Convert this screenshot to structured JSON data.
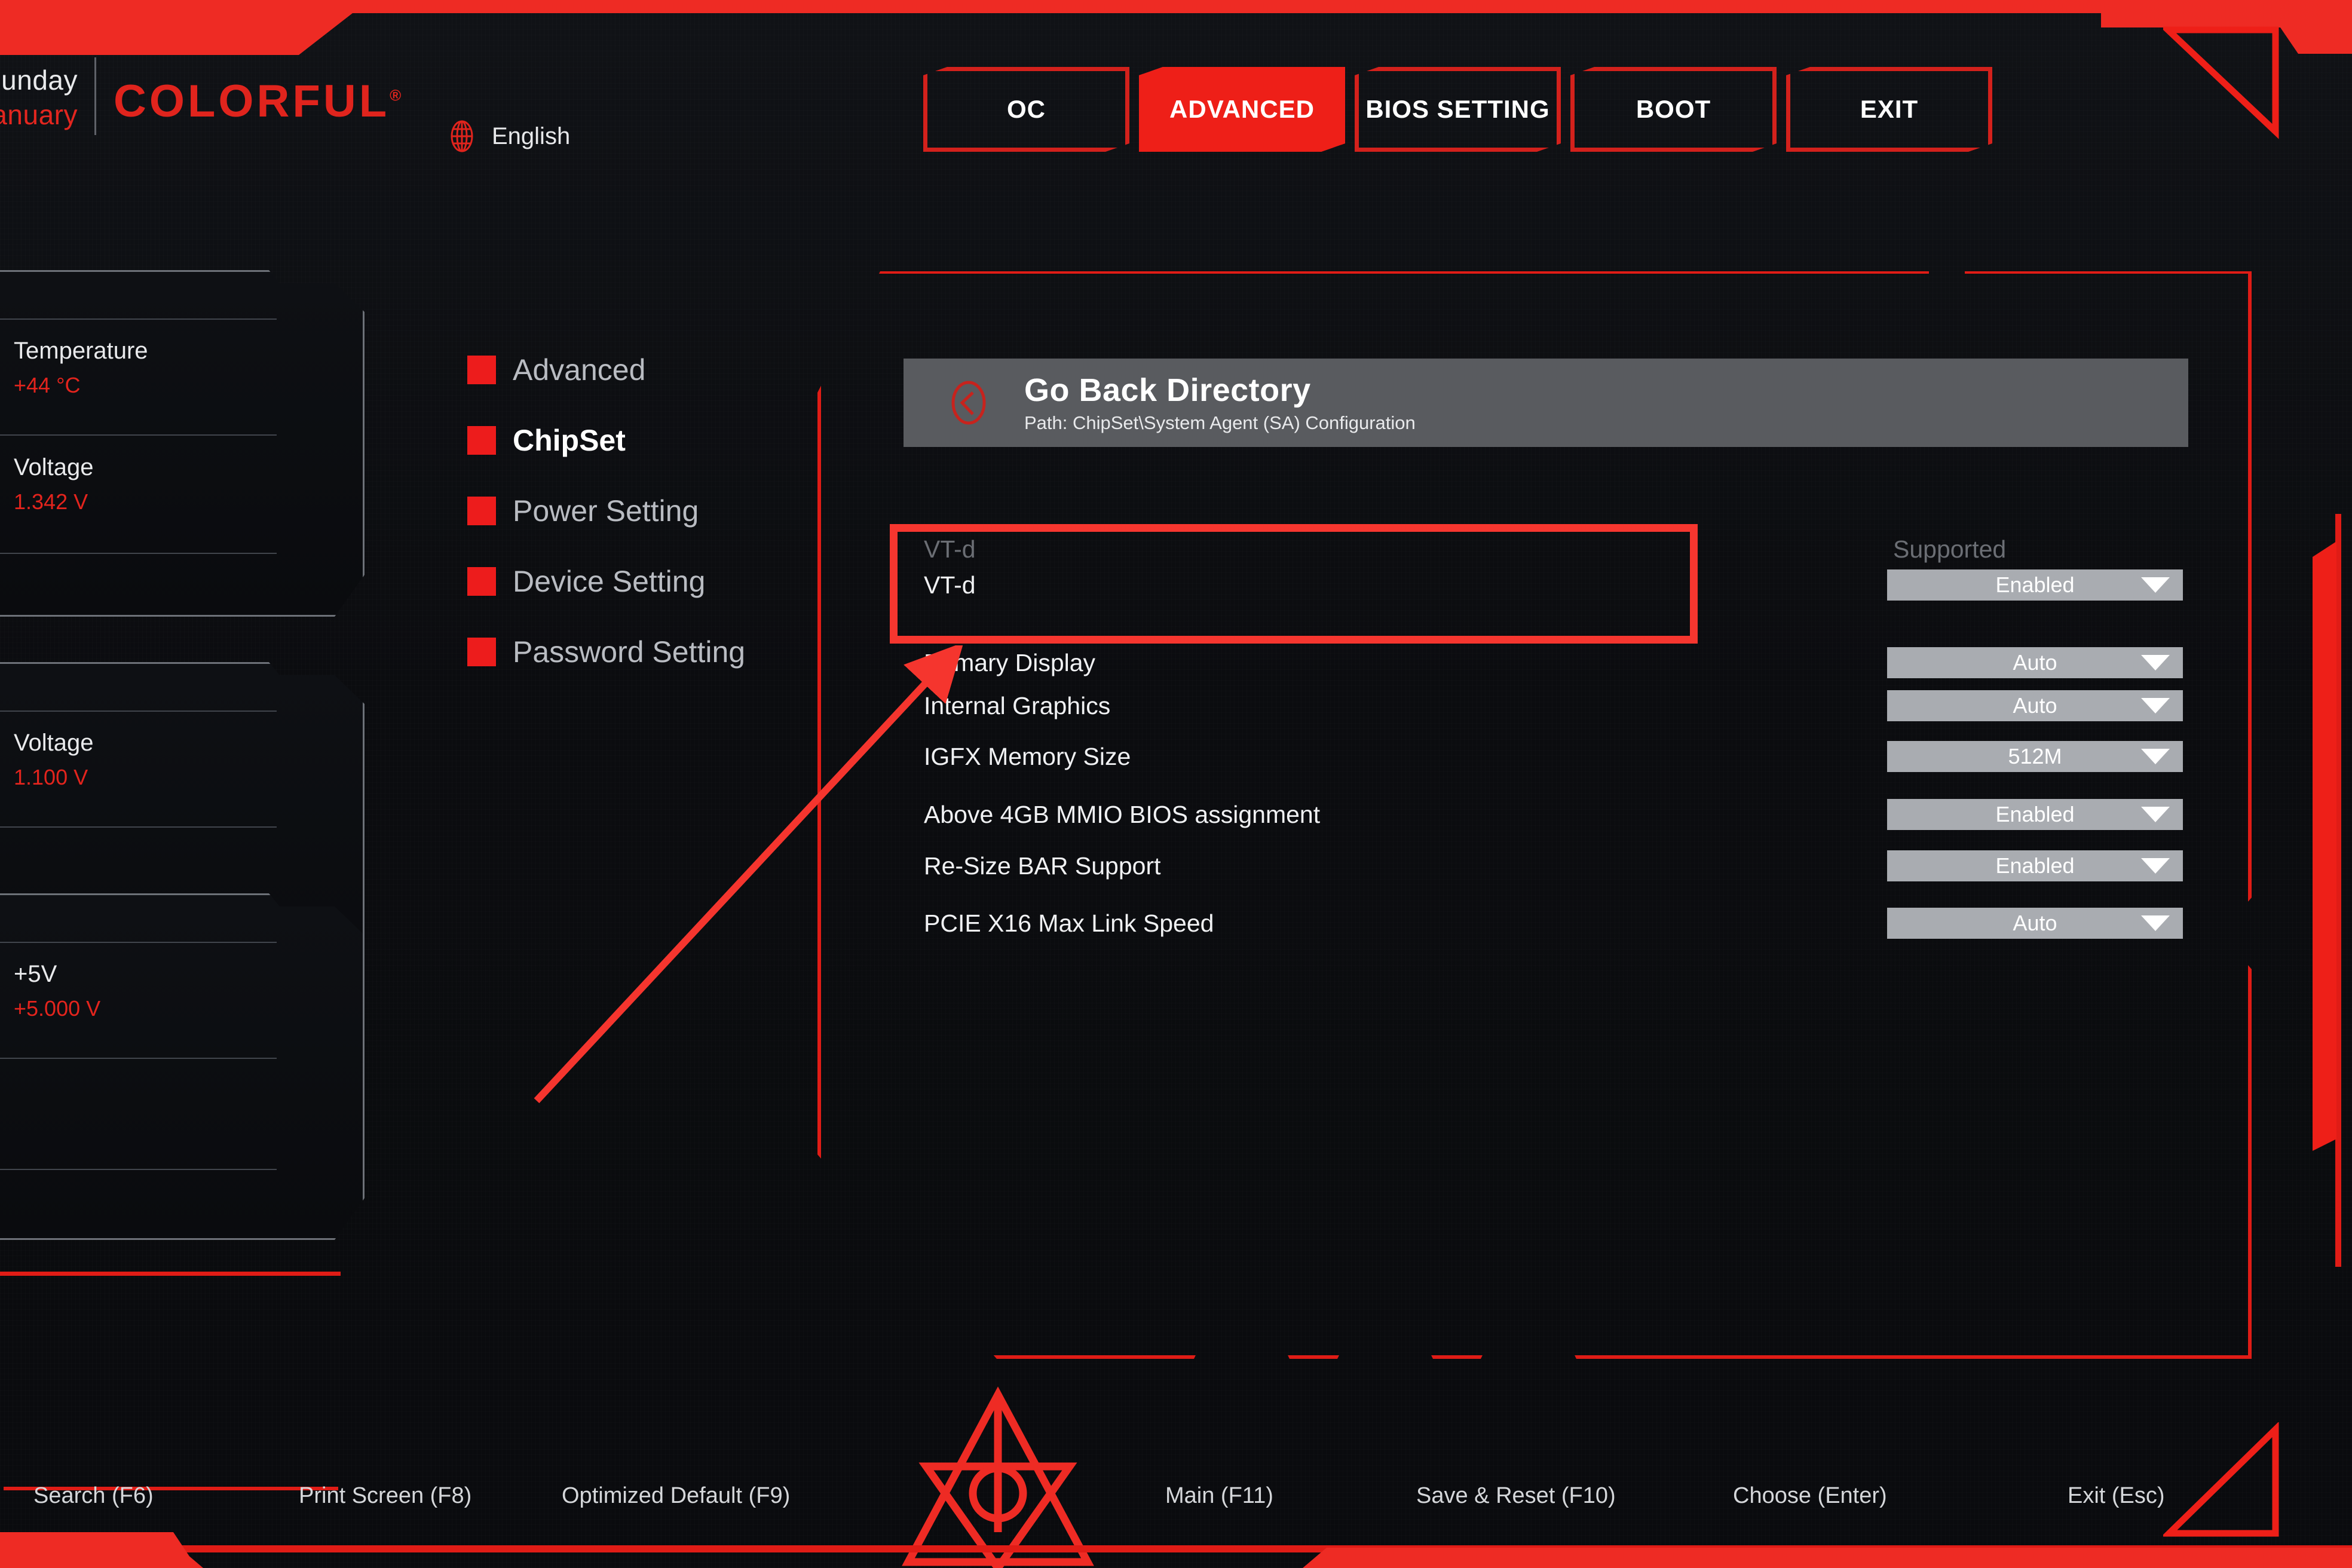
{
  "header": {
    "date_day": "Sunday",
    "date_month": "January",
    "brand": "COLORFUL",
    "brand_mark": "®",
    "language": "English",
    "globe_icon": "globe-icon"
  },
  "tabs": [
    {
      "label": "OC",
      "active": false
    },
    {
      "label": "ADVANCED",
      "active": true
    },
    {
      "label": "BIOS SETTING",
      "active": false
    },
    {
      "label": "BOOT",
      "active": false
    },
    {
      "label": "EXIT",
      "active": false
    }
  ],
  "sensors": [
    {
      "name": "Temperature",
      "value": "+44 °C"
    },
    {
      "name": "Voltage",
      "value": "1.342 V"
    },
    {
      "name": "Voltage",
      "value": "1.100 V"
    },
    {
      "name": "+5V",
      "value": "+5.000 V"
    }
  ],
  "menu": {
    "items": [
      {
        "label": "Advanced",
        "active": false
      },
      {
        "label": "ChipSet",
        "active": true
      },
      {
        "label": "Power Setting",
        "active": false
      },
      {
        "label": "Device Setting",
        "active": false
      },
      {
        "label": "Password Setting",
        "active": false
      }
    ]
  },
  "goback": {
    "icon": "back-chevron-circle-icon",
    "title": "Go Back Directory",
    "path": "Path: ChipSet\\System Agent (SA) Configuration"
  },
  "settings": {
    "rows": [
      {
        "label": "VT-d",
        "value": "Supported",
        "type": "static",
        "dim": true
      },
      {
        "label": "VT-d",
        "value": "Enabled",
        "type": "dropdown",
        "highlighted": true
      },
      {
        "label": "Primary Display",
        "value": "Auto",
        "type": "dropdown"
      },
      {
        "label": "Internal Graphics",
        "value": "Auto",
        "type": "dropdown"
      },
      {
        "label": "IGFX Memory Size",
        "value": "512M",
        "type": "dropdown"
      },
      {
        "label": "Above 4GB MMIO BIOS assignment",
        "value": "Enabled",
        "type": "dropdown"
      },
      {
        "label": "Re-Size BAR Support",
        "value": "Enabled",
        "type": "dropdown"
      },
      {
        "label": "PCIE X16 Max Link Speed",
        "value": "Auto",
        "type": "dropdown"
      }
    ]
  },
  "bottom_keys": [
    {
      "label": "Search (F6)"
    },
    {
      "label": "Print Screen (F8)"
    },
    {
      "label": "Optimized Default (F9)"
    },
    {
      "label": "Main (F11)"
    },
    {
      "label": "Save & Reset (F10)"
    },
    {
      "label": "Choose (Enter)"
    },
    {
      "label": "Exit (Esc)"
    }
  ],
  "colors": {
    "accent_red": "#ee1f18",
    "panel_outline": "#e01c16",
    "highlight_red": "#f6362f",
    "dropdown_bg": "#a9acb1",
    "value_red": "#e3241d"
  }
}
